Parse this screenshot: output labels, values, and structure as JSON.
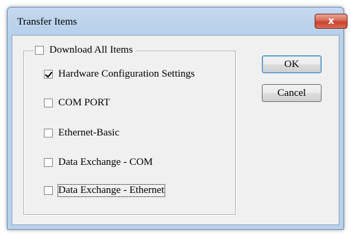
{
  "window": {
    "title": "Transfer Items",
    "close_glyph": "x"
  },
  "group": {
    "label": "Download All Items",
    "checked": false
  },
  "items": [
    {
      "label": "Hardware Configuration Settings",
      "checked": true
    },
    {
      "label": "COM PORT",
      "checked": false
    },
    {
      "label": "Ethernet-Basic",
      "checked": false
    },
    {
      "label": "Data Exchange - COM",
      "checked": false
    },
    {
      "label": "Data Exchange - Ethernet",
      "checked": false
    }
  ],
  "buttons": {
    "ok": "OK",
    "cancel": "Cancel"
  },
  "colors": {
    "titlebar": "#b9d1ea",
    "close_button": "#c8432c",
    "dialog_bg": "#f0f0f0"
  }
}
